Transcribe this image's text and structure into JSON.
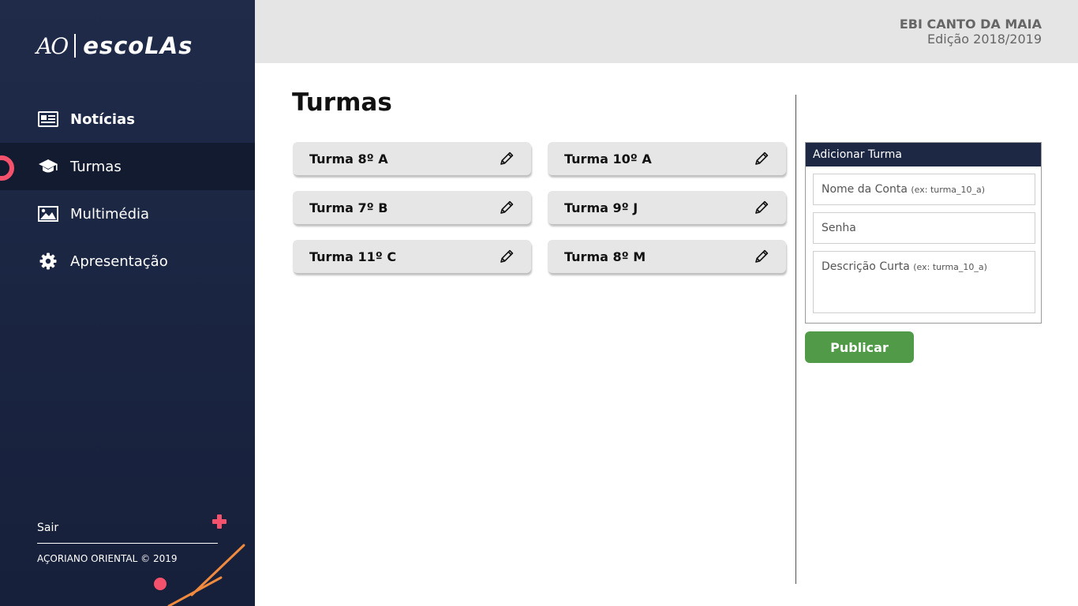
{
  "brand": {
    "logo_ao": "AO",
    "logo_escolas": "escoLAs"
  },
  "colors": {
    "sidebar_bg": "#1d2845",
    "accent_pink": "#f4516c",
    "accent_orange": "#f08a3e",
    "publish_green": "#519a48",
    "topbar_bg": "#e5e5e5"
  },
  "sidebar": {
    "items": [
      {
        "label": "Notícias",
        "icon": "newspaper-icon",
        "active": false
      },
      {
        "label": "Turmas",
        "icon": "graduation-cap-icon",
        "active": true
      },
      {
        "label": "Multimédia",
        "icon": "image-icon",
        "active": false
      },
      {
        "label": "Apresentação",
        "icon": "gear-icon",
        "active": false
      }
    ],
    "logout_label": "Sair",
    "copyright": "AÇORIANO ORIENTAL © 2019"
  },
  "header": {
    "school_name": "EBI CANTO DA MAIA",
    "edition": "Edição 2018/2019"
  },
  "main": {
    "title": "Turmas",
    "turmas": [
      {
        "label": "Turma 8º A"
      },
      {
        "label": "Turma 10º A"
      },
      {
        "label": "Turma 7º B"
      },
      {
        "label": "Turma 9º J"
      },
      {
        "label": "Turma 11º C"
      },
      {
        "label": "Turma 8º M"
      }
    ]
  },
  "form": {
    "title": "Adicionar Turma",
    "account_placeholder": "Nome da Conta",
    "account_hint": "(ex: turma_10_a)",
    "password_placeholder": "Senha",
    "description_placeholder": "Descrição Curta",
    "description_hint": "(ex: turma_10_a)",
    "submit_label": "Publicar"
  }
}
